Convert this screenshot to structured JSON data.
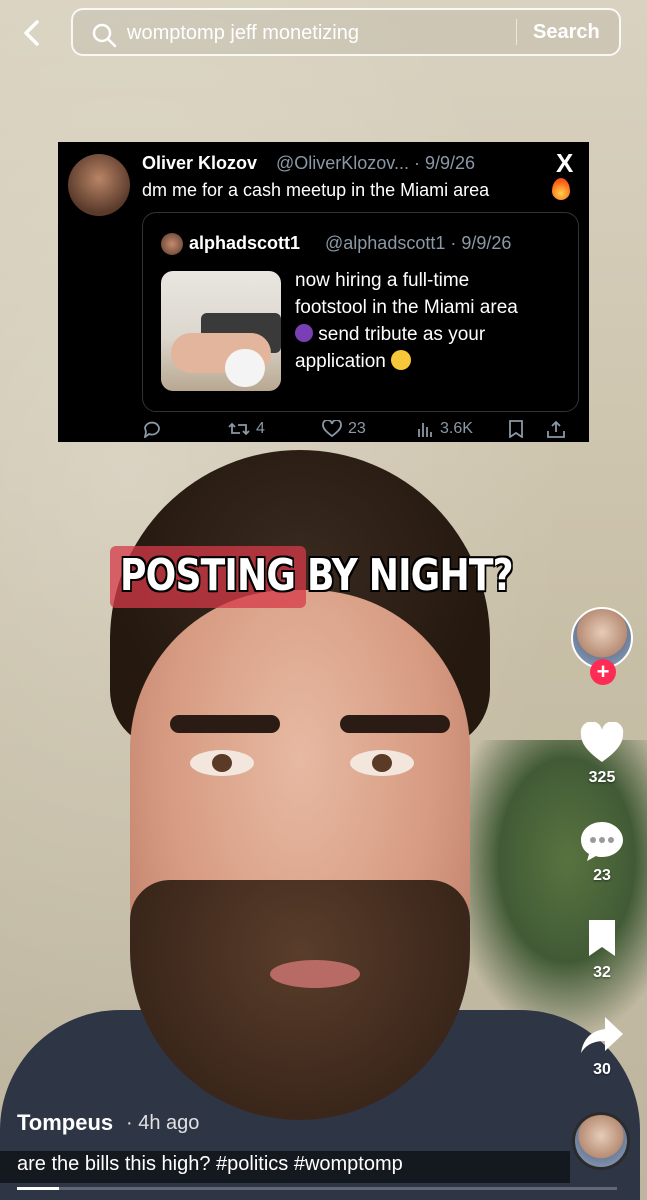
{
  "search": {
    "query": "womptomp jeff monetizing",
    "button_label": "Search"
  },
  "tweet": {
    "name": "Oliver Klozov",
    "handle": "@OliverKlozov... · 9/9/26",
    "text": "dm me for a cash meetup in the Miami area",
    "quote": {
      "name": "alphadscott1",
      "handle": "@alphadscott1 · 9/9/26",
      "text_line1": "now hiring a full-time",
      "text_line2": "footstool in the Miami area",
      "text_line3": "send tribute as your",
      "text_line4": "application"
    },
    "retweets": "4",
    "likes": "23",
    "views": "3.6K",
    "x_logo": "X"
  },
  "caption": "POSTING BY NIGHT?",
  "rail": {
    "likes": "325",
    "comments": "23",
    "bookmarks": "32",
    "shares": "30",
    "follow_symbol": "+"
  },
  "post": {
    "author": "Tompeus",
    "time": "· 4h ago",
    "description": "are the bills this high? #politics #womptomp",
    "progress": 0.07
  },
  "colors": {
    "accent": "#fe2c55",
    "tweet_bg": "#000000",
    "tweet_gray": "#8b98a5"
  }
}
